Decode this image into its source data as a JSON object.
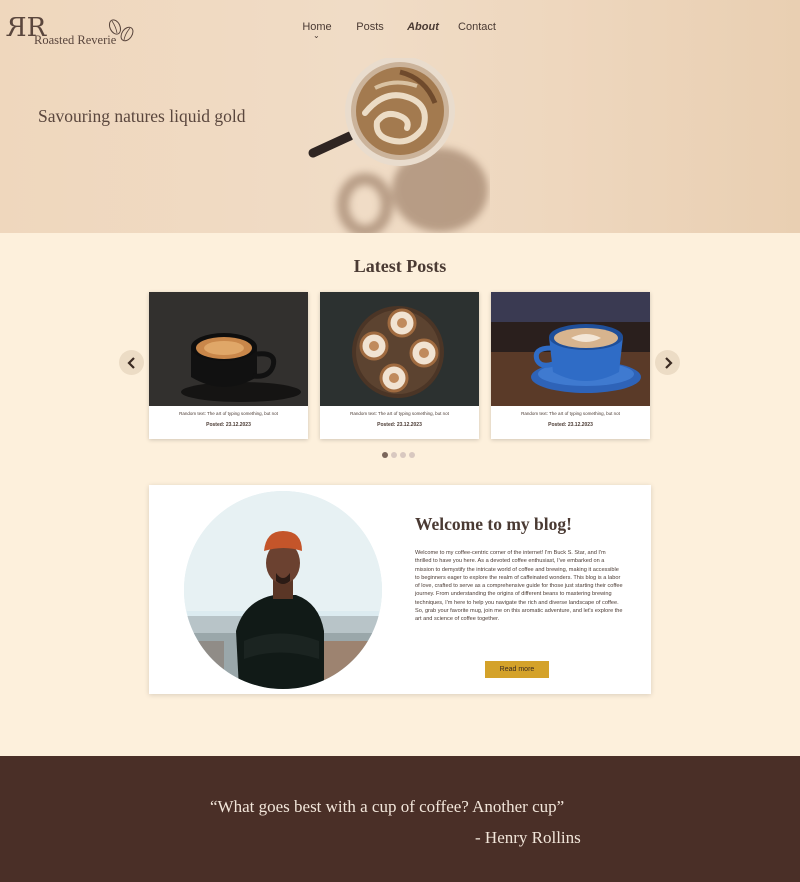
{
  "brand": {
    "name": "Roasted Reverie",
    "monogram": "RR"
  },
  "nav": {
    "items": [
      {
        "label": "Home"
      },
      {
        "label": "Posts"
      },
      {
        "label": "About"
      },
      {
        "label": "Contact"
      }
    ]
  },
  "hero": {
    "tagline": "Savouring natures liquid gold"
  },
  "latest_posts": {
    "title": "Latest Posts",
    "cards": [
      {
        "text": "Random text: The art of typing something, but not",
        "date": "Posted: 23.12.2023"
      },
      {
        "text": "Random text: The art of typing something, but not",
        "date": "Posted: 23.12.2023"
      },
      {
        "text": "Random text: The art of typing something, but not",
        "date": "Posted: 23.12.2023"
      }
    ],
    "active_page": 1,
    "page_count": 4
  },
  "welcome": {
    "title": "Welcome to my blog!",
    "body": "Welcome to my coffee-centric corner of the internet! I'm Buck S. Star, and I'm thrilled to have you here. As a devoted coffee enthusiast, I've embarked on a mission to demystify the intricate world of coffee and brewing, making it accessible to beginners eager to explore the realm of caffeinated wonders. This blog is a labor of love, crafted to serve as a comprehensive guide for those just starting their coffee journey. From understanding the origins of different beans to mastering brewing techniques, I'm here to help you navigate the rich and diverse landscape of coffee. So, grab your favorite mug, join me on this aromatic adventure, and let's explore the art and science of coffee together.",
    "button_label": "Read more"
  },
  "quote": {
    "text": "“What goes best with a cup of coffee? Another cup”",
    "author": "- Henry Rollins"
  },
  "colors": {
    "background": "#fdf0dc",
    "hero": "#efd7bd",
    "text": "#4a3a33",
    "button": "#d4a22a",
    "footer": "#4a2f27",
    "footer_text": "#f2e6da"
  },
  "icons": [
    "coffee-beans-icon",
    "chevron-down-icon",
    "chevron-left-icon",
    "chevron-right-icon"
  ]
}
